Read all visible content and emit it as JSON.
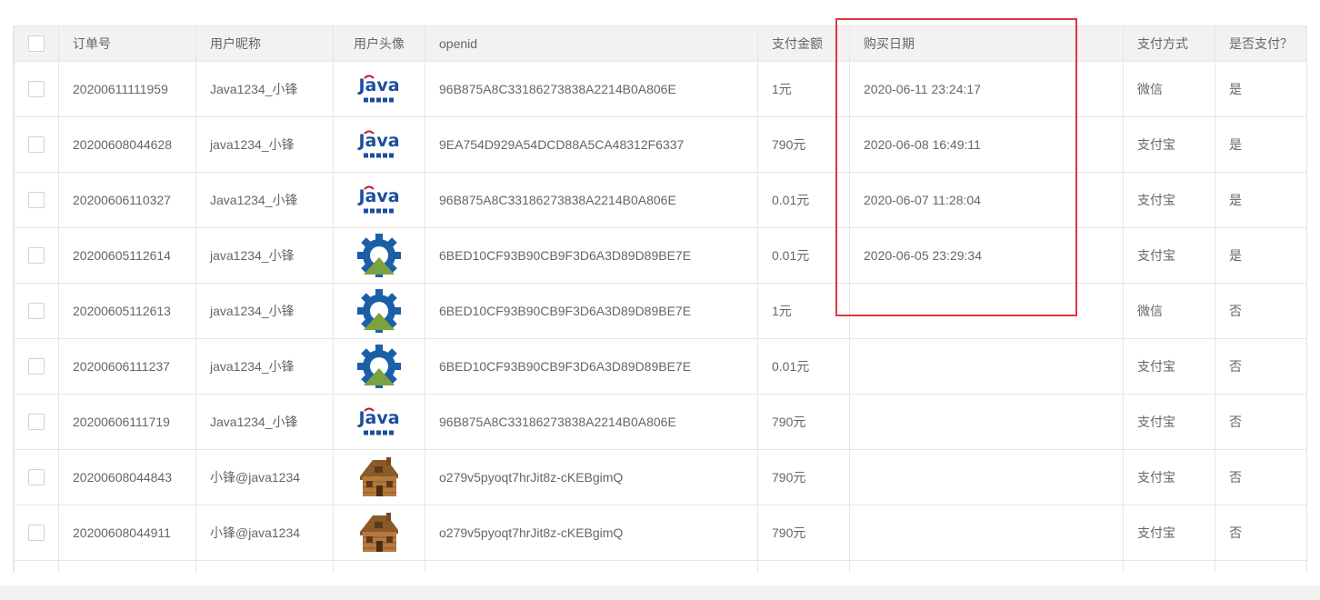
{
  "table": {
    "headers": [
      "订单号",
      "用户昵称",
      "用户头像",
      "openid",
      "支付金额",
      "购买日期",
      "支付方式",
      "是否支付？"
    ],
    "rows": [
      {
        "order_no": "20200611111959",
        "nickname": "Java1234_小锋",
        "avatar": "java-logo",
        "openid": "96B875A8C33186273838A2214B0A806E",
        "amount": "1元",
        "date": "2020-06-11 23:24:17",
        "pay_method": "微信",
        "paid": "是"
      },
      {
        "order_no": "20200608044628",
        "nickname": "java1234_小锋",
        "avatar": "java-logo",
        "openid": "9EA754D929A54DCD88A5CA48312F6337",
        "amount": "790元",
        "date": "2020-06-08 16:49:11",
        "pay_method": "支付宝",
        "paid": "是"
      },
      {
        "order_no": "20200606110327",
        "nickname": "Java1234_小锋",
        "avatar": "java-logo",
        "openid": "96B875A8C33186273838A2214B0A806E",
        "amount": "0.01元",
        "date": "2020-06-07 11:28:04",
        "pay_method": "支付宝",
        "paid": "是"
      },
      {
        "order_no": "20200605112614",
        "nickname": "java1234_小锋",
        "avatar": "gear-logo",
        "openid": "6BED10CF93B90CB9F3D6A3D89D89BE7E",
        "amount": "0.01元",
        "date": "2020-06-05 23:29:34",
        "pay_method": "支付宝",
        "paid": "是"
      },
      {
        "order_no": "20200605112613",
        "nickname": "java1234_小锋",
        "avatar": "gear-logo",
        "openid": "6BED10CF93B90CB9F3D6A3D89D89BE7E",
        "amount": "1元",
        "date": "",
        "pay_method": "微信",
        "paid": "否"
      },
      {
        "order_no": "20200606111237",
        "nickname": "java1234_小锋",
        "avatar": "gear-logo",
        "openid": "6BED10CF93B90CB9F3D6A3D89D89BE7E",
        "amount": "0.01元",
        "date": "",
        "pay_method": "支付宝",
        "paid": "否"
      },
      {
        "order_no": "20200606111719",
        "nickname": "Java1234_小锋",
        "avatar": "java-logo",
        "openid": "96B875A8C33186273838A2214B0A806E",
        "amount": "790元",
        "date": "",
        "pay_method": "支付宝",
        "paid": "否"
      },
      {
        "order_no": "20200608044843",
        "nickname": "小锋@java1234",
        "avatar": "house-image",
        "openid": "o279v5pyoqt7hrJit8z-cKEBgimQ",
        "amount": "790元",
        "date": "",
        "pay_method": "支付宝",
        "paid": "否"
      },
      {
        "order_no": "20200608044911",
        "nickname": "小锋@java1234",
        "avatar": "house-image",
        "openid": "o279v5pyoqt7hrJit8z-cKEBgimQ",
        "amount": "790元",
        "date": "",
        "pay_method": "支付宝",
        "paid": "否"
      }
    ]
  },
  "colors": {
    "highlight": "#e0393e",
    "header_bg": "#f2f2f2",
    "border": "#e6e6e6",
    "java_blue": "#1c4e9c",
    "java_red": "#c8102e",
    "gear_blue": "#1a5fa8",
    "gear_green": "#7ba23f"
  }
}
